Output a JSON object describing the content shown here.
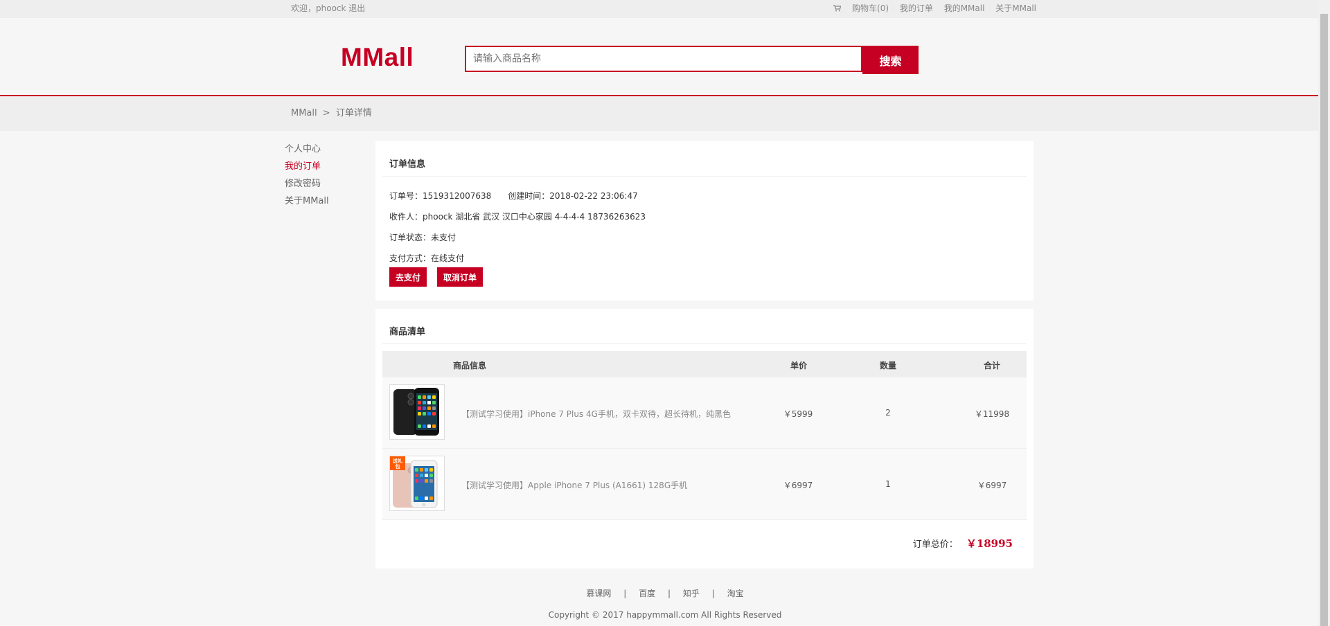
{
  "topbar": {
    "welcome": "欢迎，phoock",
    "logout": "退出",
    "cart_label": "购物车(0)",
    "my_orders": "我的订单",
    "my_mall": "我的MMall",
    "about": "关于MMall"
  },
  "header": {
    "logo": "MMall",
    "search_placeholder": "请输入商品名称",
    "search_button": "搜索"
  },
  "breadcrumb": {
    "home": "MMall",
    "separator": ">",
    "current": "订单详情"
  },
  "sidebar": {
    "items": [
      {
        "label": "个人中心",
        "active": false
      },
      {
        "label": "我的订单",
        "active": true
      },
      {
        "label": "修改密码",
        "active": false
      },
      {
        "label": "关于MMall",
        "active": false
      }
    ]
  },
  "order_info": {
    "title": "订单信息",
    "order_no_label": "订单号：",
    "order_no": "1519312007638",
    "create_time_label": "创建时间：",
    "create_time": "2018-02-22 23:06:47",
    "receiver_label": "收件人：",
    "receiver": "phoock 湖北省 武汉 汉口中心家园 4-4-4-4 18736263623",
    "status_label": "订单状态：",
    "status": "未支付",
    "payment_label": "支付方式：",
    "payment": "在线支付",
    "pay_button": "去支付",
    "cancel_button": "取消订单"
  },
  "goods_list": {
    "title": "商品清单",
    "columns": [
      "商品信息",
      "单价",
      "数量",
      "合计"
    ],
    "items": [
      {
        "name": "【测试学习使用】iPhone 7 Plus 4G手机，双卡双待，超长待机，纯黑色",
        "price": "￥5999",
        "quantity": "2",
        "total": "￥11998"
      },
      {
        "name": "【测试学习使用】Apple iPhone 7 Plus (A1661) 128G手机",
        "price": "￥6997",
        "quantity": "1",
        "total": "￥6997",
        "badge": "送礼包"
      }
    ],
    "total_label": "订单总价：",
    "total_amount": "￥18995"
  },
  "footer": {
    "links": [
      "慕课网",
      "百度",
      "知乎",
      "淘宝"
    ],
    "separator": "|",
    "copyright": "Copyright © 2017 happymmall.com All Rights Reserved"
  },
  "colors": {
    "brand": "#c60023",
    "background": "#f6f6f6"
  }
}
